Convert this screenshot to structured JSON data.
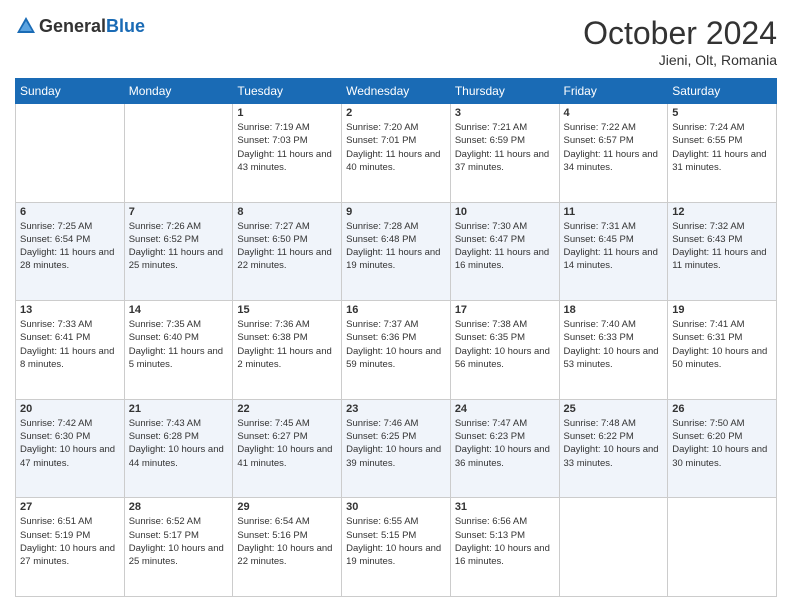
{
  "header": {
    "logo_general": "General",
    "logo_blue": "Blue",
    "month_year": "October 2024",
    "location": "Jieni, Olt, Romania"
  },
  "days_of_week": [
    "Sunday",
    "Monday",
    "Tuesday",
    "Wednesday",
    "Thursday",
    "Friday",
    "Saturday"
  ],
  "weeks": [
    [
      {
        "day": "",
        "info": ""
      },
      {
        "day": "",
        "info": ""
      },
      {
        "day": "1",
        "info": "Sunrise: 7:19 AM\nSunset: 7:03 PM\nDaylight: 11 hours and 43 minutes."
      },
      {
        "day": "2",
        "info": "Sunrise: 7:20 AM\nSunset: 7:01 PM\nDaylight: 11 hours and 40 minutes."
      },
      {
        "day": "3",
        "info": "Sunrise: 7:21 AM\nSunset: 6:59 PM\nDaylight: 11 hours and 37 minutes."
      },
      {
        "day": "4",
        "info": "Sunrise: 7:22 AM\nSunset: 6:57 PM\nDaylight: 11 hours and 34 minutes."
      },
      {
        "day": "5",
        "info": "Sunrise: 7:24 AM\nSunset: 6:55 PM\nDaylight: 11 hours and 31 minutes."
      }
    ],
    [
      {
        "day": "6",
        "info": "Sunrise: 7:25 AM\nSunset: 6:54 PM\nDaylight: 11 hours and 28 minutes."
      },
      {
        "day": "7",
        "info": "Sunrise: 7:26 AM\nSunset: 6:52 PM\nDaylight: 11 hours and 25 minutes."
      },
      {
        "day": "8",
        "info": "Sunrise: 7:27 AM\nSunset: 6:50 PM\nDaylight: 11 hours and 22 minutes."
      },
      {
        "day": "9",
        "info": "Sunrise: 7:28 AM\nSunset: 6:48 PM\nDaylight: 11 hours and 19 minutes."
      },
      {
        "day": "10",
        "info": "Sunrise: 7:30 AM\nSunset: 6:47 PM\nDaylight: 11 hours and 16 minutes."
      },
      {
        "day": "11",
        "info": "Sunrise: 7:31 AM\nSunset: 6:45 PM\nDaylight: 11 hours and 14 minutes."
      },
      {
        "day": "12",
        "info": "Sunrise: 7:32 AM\nSunset: 6:43 PM\nDaylight: 11 hours and 11 minutes."
      }
    ],
    [
      {
        "day": "13",
        "info": "Sunrise: 7:33 AM\nSunset: 6:41 PM\nDaylight: 11 hours and 8 minutes."
      },
      {
        "day": "14",
        "info": "Sunrise: 7:35 AM\nSunset: 6:40 PM\nDaylight: 11 hours and 5 minutes."
      },
      {
        "day": "15",
        "info": "Sunrise: 7:36 AM\nSunset: 6:38 PM\nDaylight: 11 hours and 2 minutes."
      },
      {
        "day": "16",
        "info": "Sunrise: 7:37 AM\nSunset: 6:36 PM\nDaylight: 10 hours and 59 minutes."
      },
      {
        "day": "17",
        "info": "Sunrise: 7:38 AM\nSunset: 6:35 PM\nDaylight: 10 hours and 56 minutes."
      },
      {
        "day": "18",
        "info": "Sunrise: 7:40 AM\nSunset: 6:33 PM\nDaylight: 10 hours and 53 minutes."
      },
      {
        "day": "19",
        "info": "Sunrise: 7:41 AM\nSunset: 6:31 PM\nDaylight: 10 hours and 50 minutes."
      }
    ],
    [
      {
        "day": "20",
        "info": "Sunrise: 7:42 AM\nSunset: 6:30 PM\nDaylight: 10 hours and 47 minutes."
      },
      {
        "day": "21",
        "info": "Sunrise: 7:43 AM\nSunset: 6:28 PM\nDaylight: 10 hours and 44 minutes."
      },
      {
        "day": "22",
        "info": "Sunrise: 7:45 AM\nSunset: 6:27 PM\nDaylight: 10 hours and 41 minutes."
      },
      {
        "day": "23",
        "info": "Sunrise: 7:46 AM\nSunset: 6:25 PM\nDaylight: 10 hours and 39 minutes."
      },
      {
        "day": "24",
        "info": "Sunrise: 7:47 AM\nSunset: 6:23 PM\nDaylight: 10 hours and 36 minutes."
      },
      {
        "day": "25",
        "info": "Sunrise: 7:48 AM\nSunset: 6:22 PM\nDaylight: 10 hours and 33 minutes."
      },
      {
        "day": "26",
        "info": "Sunrise: 7:50 AM\nSunset: 6:20 PM\nDaylight: 10 hours and 30 minutes."
      }
    ],
    [
      {
        "day": "27",
        "info": "Sunrise: 6:51 AM\nSunset: 5:19 PM\nDaylight: 10 hours and 27 minutes."
      },
      {
        "day": "28",
        "info": "Sunrise: 6:52 AM\nSunset: 5:17 PM\nDaylight: 10 hours and 25 minutes."
      },
      {
        "day": "29",
        "info": "Sunrise: 6:54 AM\nSunset: 5:16 PM\nDaylight: 10 hours and 22 minutes."
      },
      {
        "day": "30",
        "info": "Sunrise: 6:55 AM\nSunset: 5:15 PM\nDaylight: 10 hours and 19 minutes."
      },
      {
        "day": "31",
        "info": "Sunrise: 6:56 AM\nSunset: 5:13 PM\nDaylight: 10 hours and 16 minutes."
      },
      {
        "day": "",
        "info": ""
      },
      {
        "day": "",
        "info": ""
      }
    ]
  ]
}
